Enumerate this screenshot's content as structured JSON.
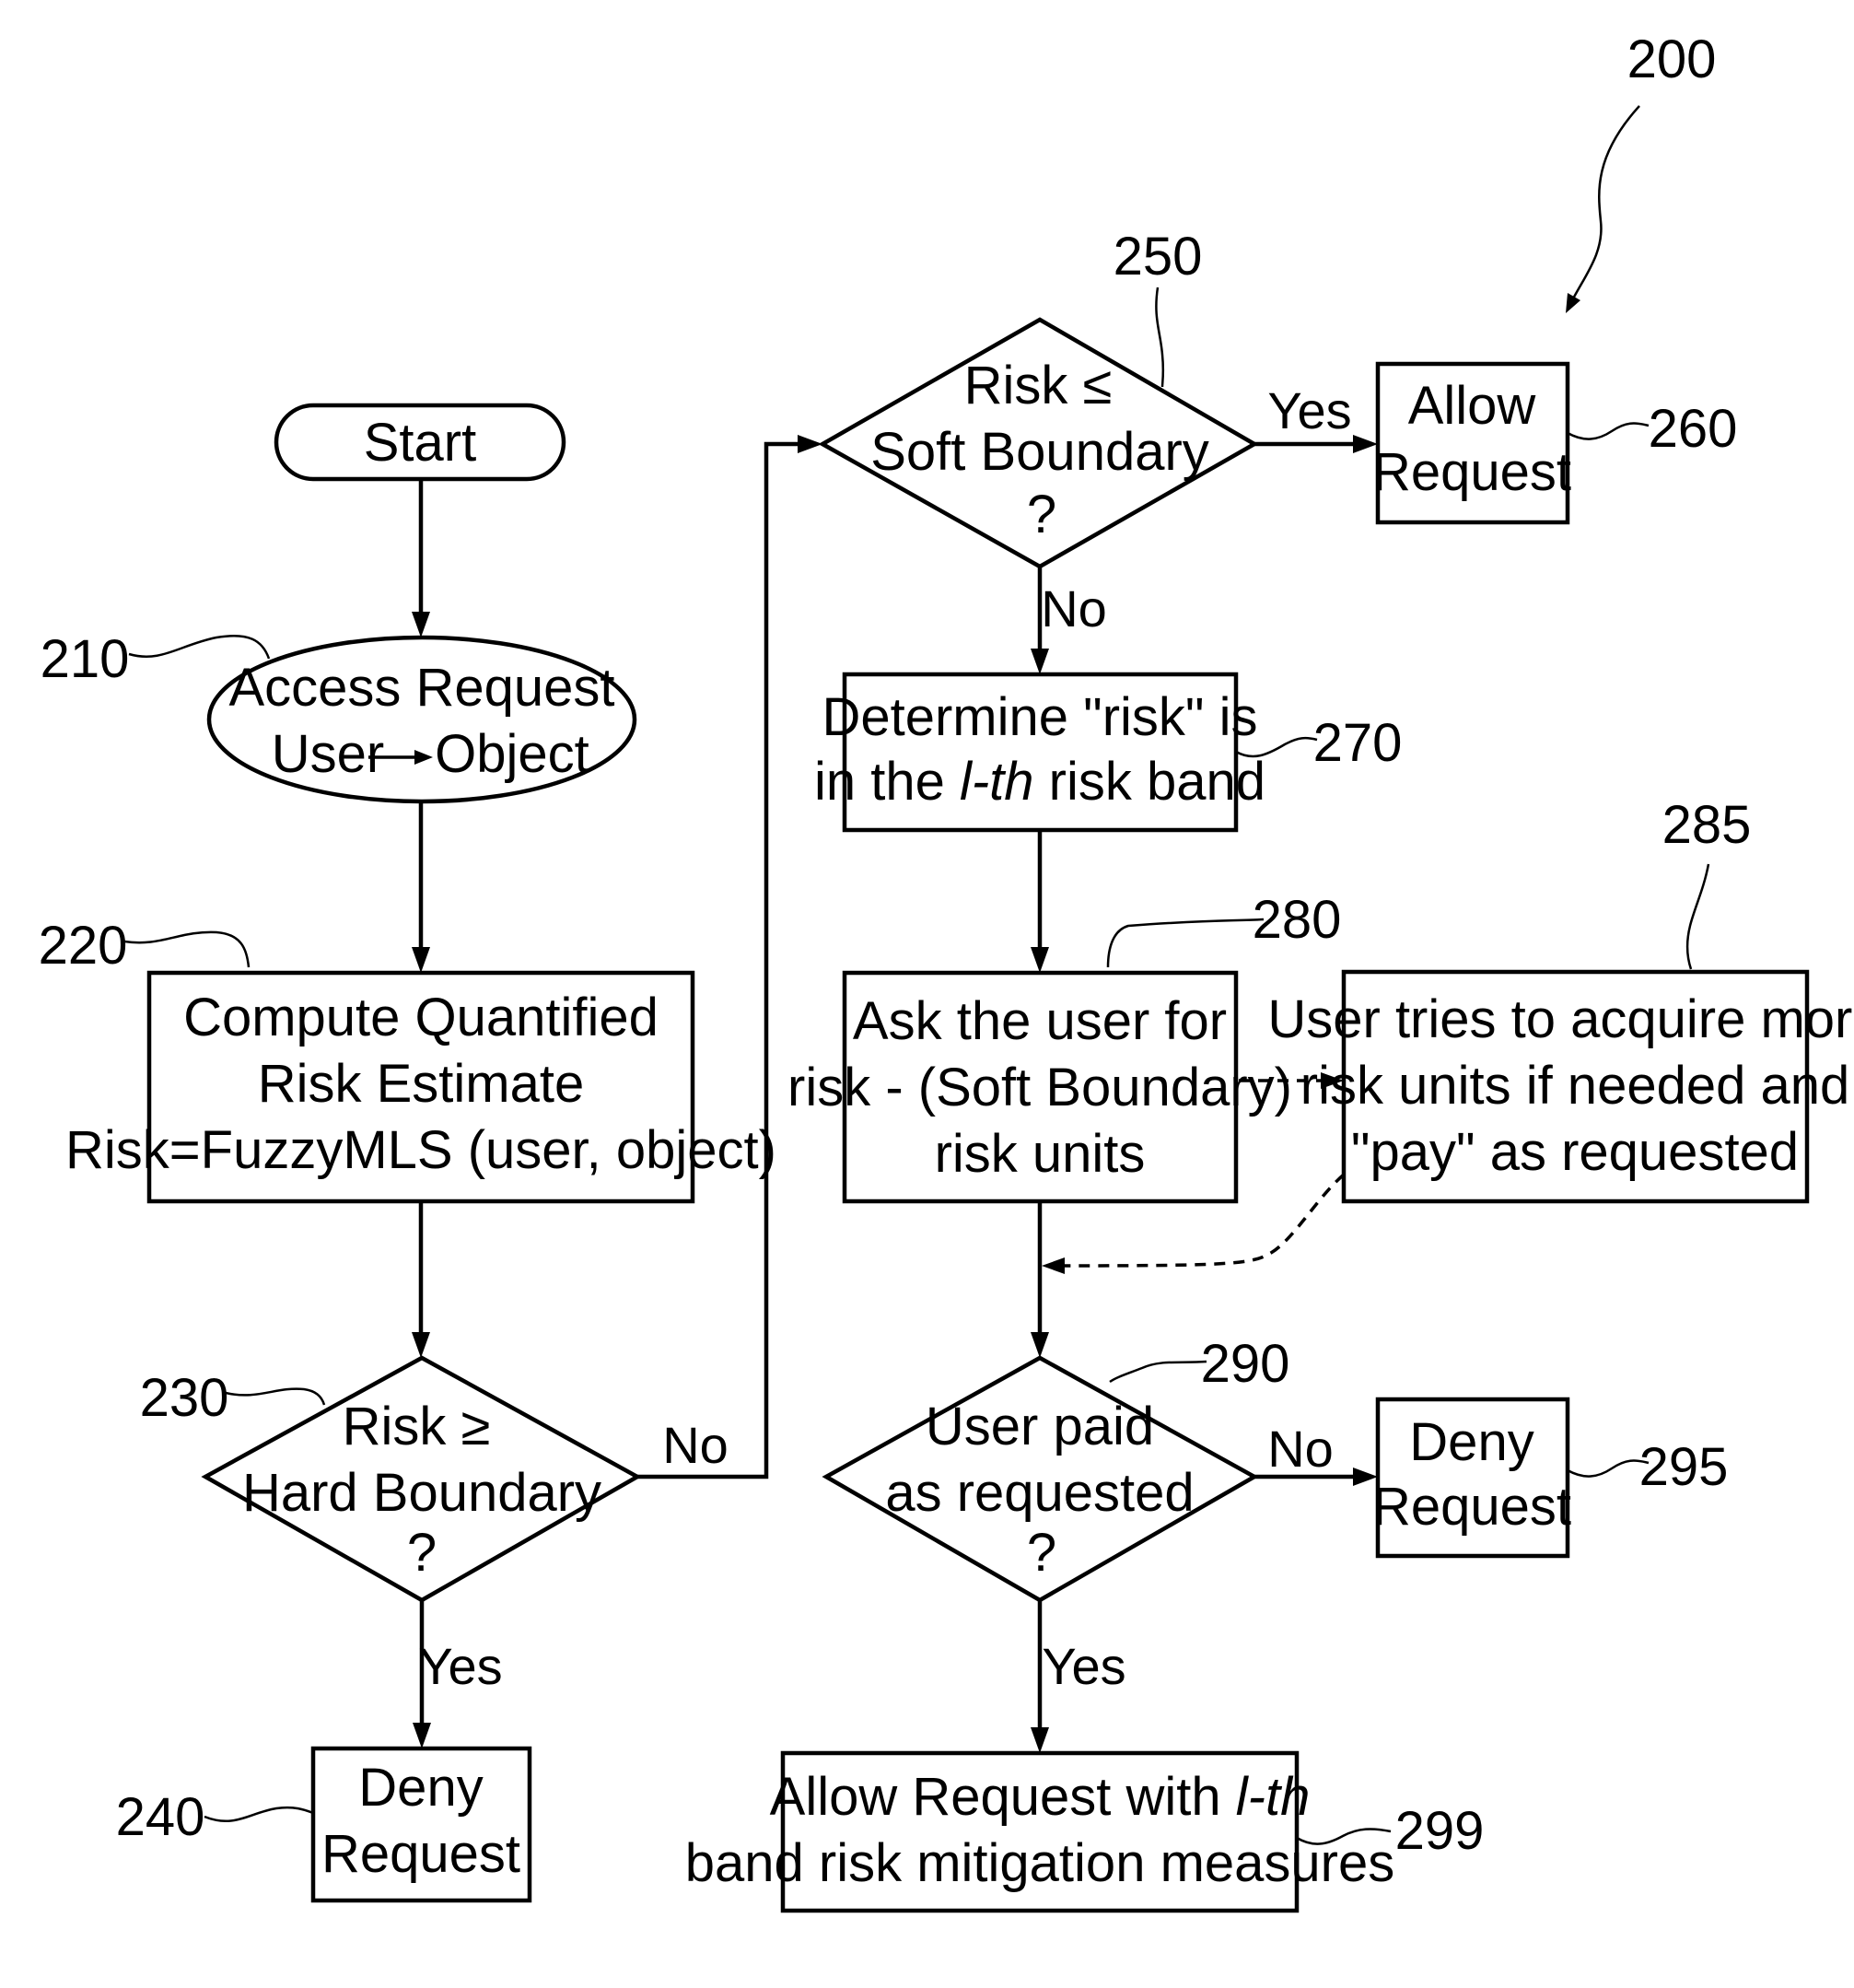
{
  "figure": {
    "ref": "200",
    "nodes": {
      "start": {
        "lines": [
          "Start"
        ]
      },
      "n210": {
        "ref": "210",
        "lines": [
          "Access Request",
          "User",
          "Object"
        ]
      },
      "n220": {
        "ref": "220",
        "lines": [
          "Compute Quantified",
          "Risk Estimate",
          "Risk=FuzzyMLS (user, object)"
        ]
      },
      "n230": {
        "ref": "230",
        "lines": [
          "Risk ≥",
          "Hard Boundary",
          "?"
        ]
      },
      "n240": {
        "ref": "240",
        "lines": [
          "Deny",
          "Request"
        ]
      },
      "n250": {
        "ref": "250",
        "lines": [
          "Risk ≤",
          "Soft Boundary",
          "?"
        ]
      },
      "n260": {
        "ref": "260",
        "lines": [
          "Allow",
          "Request"
        ]
      },
      "n270": {
        "ref": "270",
        "line1": "Determine \"risk\" is",
        "line2_pre": "in the ",
        "line2_italic": "l-th",
        "line2_post": " risk band"
      },
      "n280": {
        "ref": "280",
        "lines": [
          "Ask the user for",
          "risk - (Soft Boundary)",
          "risk units"
        ]
      },
      "n285": {
        "ref": "285",
        "lines": [
          "User tries to acquire more",
          "risk units if needed and",
          "\"pay\" as requested"
        ]
      },
      "n290": {
        "ref": "290",
        "lines": [
          "User paid",
          "as requested",
          "?"
        ]
      },
      "n295": {
        "ref": "295",
        "lines": [
          "Deny",
          "Request"
        ]
      },
      "n299": {
        "ref": "299",
        "line1_pre": "Allow Request with ",
        "line1_italic": "l-th",
        "line2": "band risk mitigation measures"
      }
    },
    "edge_labels": {
      "e230_yes": "Yes",
      "e230_no": "No",
      "e250_yes": "Yes",
      "e250_no": "No",
      "e290_no": "No",
      "e290_yes": "Yes"
    }
  }
}
